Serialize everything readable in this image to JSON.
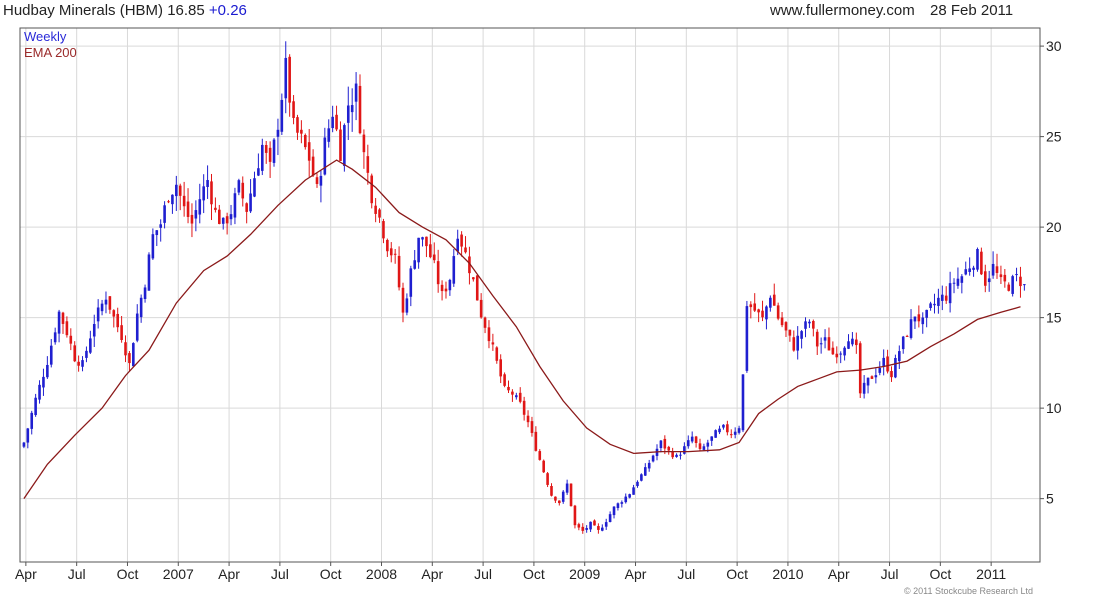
{
  "header": {
    "symbol_text": "Hudbay Minerals (HBM) 16.85",
    "change": "+0.26",
    "site": "www.fullermoney.com",
    "date": "28 Feb 2011"
  },
  "legend": {
    "weekly": "Weekly",
    "ema": "EMA 200"
  },
  "credit": "© 2011 Stockcube Research Ltd",
  "colors": {
    "up": "#1f1fd0",
    "down": "#e01616",
    "ema": "#8b1a1a",
    "grid": "#d9d9d9",
    "axis": "#555555"
  },
  "chart_data": {
    "type": "candlestick",
    "ylim": [
      1.5,
      31
    ],
    "yticks": [
      5,
      10,
      15,
      20,
      25,
      30
    ],
    "xlabels": [
      {
        "label": "Apr",
        "x": 0.5
      },
      {
        "label": "Jul",
        "x": 13.5
      },
      {
        "label": "Oct",
        "x": 26.5
      },
      {
        "label": "2007",
        "x": 39.5
      },
      {
        "label": "Apr",
        "x": 52.5
      },
      {
        "label": "Jul",
        "x": 65.5
      },
      {
        "label": "Oct",
        "x": 78.5
      },
      {
        "label": "2008",
        "x": 91.5
      },
      {
        "label": "Apr",
        "x": 104.5
      },
      {
        "label": "Jul",
        "x": 117.5
      },
      {
        "label": "Oct",
        "x": 130.5
      },
      {
        "label": "2009",
        "x": 143.5
      },
      {
        "label": "Apr",
        "x": 156.5
      },
      {
        "label": "Jul",
        "x": 169.5
      },
      {
        "label": "Oct",
        "x": 182.5
      },
      {
        "label": "2010",
        "x": 195.5
      },
      {
        "label": "Apr",
        "x": 208.5
      },
      {
        "label": "Jul",
        "x": 221.5
      },
      {
        "label": "Oct",
        "x": 234.5
      },
      {
        "label": "2011",
        "x": 247.5
      }
    ],
    "xrange": [
      -1,
      260
    ],
    "series": [
      {
        "name": "Weekly",
        "kind": "candles"
      },
      {
        "name": "EMA 200",
        "kind": "line"
      }
    ],
    "ema": [
      [
        0,
        5.0
      ],
      [
        6,
        6.9
      ],
      [
        13,
        8.5
      ],
      [
        20,
        10.0
      ],
      [
        26,
        11.8
      ],
      [
        32,
        13.2
      ],
      [
        39,
        15.8
      ],
      [
        46,
        17.6
      ],
      [
        52,
        18.4
      ],
      [
        58,
        19.6
      ],
      [
        65,
        21.2
      ],
      [
        72,
        22.6
      ],
      [
        80,
        23.7
      ],
      [
        84,
        23.2
      ],
      [
        90,
        22.2
      ],
      [
        96,
        20.8
      ],
      [
        102,
        20.0
      ],
      [
        108,
        19.3
      ],
      [
        114,
        18.0
      ],
      [
        120,
        16.2
      ],
      [
        126,
        14.5
      ],
      [
        132,
        12.3
      ],
      [
        138,
        10.4
      ],
      [
        144,
        8.9
      ],
      [
        150,
        8.0
      ],
      [
        156,
        7.5
      ],
      [
        163,
        7.6
      ],
      [
        170,
        7.6
      ],
      [
        178,
        7.7
      ],
      [
        183,
        8.1
      ],
      [
        188,
        9.7
      ],
      [
        193,
        10.5
      ],
      [
        198,
        11.2
      ],
      [
        203,
        11.6
      ],
      [
        208,
        12.0
      ],
      [
        214,
        12.1
      ],
      [
        220,
        12.3
      ],
      [
        226,
        12.6
      ],
      [
        232,
        13.4
      ],
      [
        238,
        14.1
      ],
      [
        244,
        14.9
      ],
      [
        250,
        15.3
      ],
      [
        255,
        15.6
      ]
    ],
    "anchors": [
      [
        0,
        8.1
      ],
      [
        3,
        10.5
      ],
      [
        6,
        12.6
      ],
      [
        9,
        15.3
      ],
      [
        11,
        14.2
      ],
      [
        13,
        12.8
      ],
      [
        15,
        12.4
      ],
      [
        18,
        14.8
      ],
      [
        21,
        16.2
      ],
      [
        23,
        15.0
      ],
      [
        25,
        14.0
      ],
      [
        27,
        12.4
      ],
      [
        29,
        15.2
      ],
      [
        31,
        17.0
      ],
      [
        33,
        19.5
      ],
      [
        35,
        20.2
      ],
      [
        37,
        21.8
      ],
      [
        39,
        22.4
      ],
      [
        41,
        21.0
      ],
      [
        43,
        20.2
      ],
      [
        45,
        21.6
      ],
      [
        47,
        22.6
      ],
      [
        49,
        20.8
      ],
      [
        51,
        20.1
      ],
      [
        53,
        20.9
      ],
      [
        55,
        22.2
      ],
      [
        57,
        21.0
      ],
      [
        59,
        22.8
      ],
      [
        61,
        24.5
      ],
      [
        63,
        23.2
      ],
      [
        65,
        25.8
      ],
      [
        67,
        28.8
      ],
      [
        69,
        25.5
      ],
      [
        71,
        24.8
      ],
      [
        73,
        23.8
      ],
      [
        75,
        22.0
      ],
      [
        77,
        24.6
      ],
      [
        79,
        26.4
      ],
      [
        81,
        24.2
      ],
      [
        83,
        26.8
      ],
      [
        85,
        27.5
      ],
      [
        87,
        24.0
      ],
      [
        89,
        21.8
      ],
      [
        91,
        20.5
      ],
      [
        93,
        19.0
      ],
      [
        95,
        18.2
      ],
      [
        97,
        15.2
      ],
      [
        99,
        17.5
      ],
      [
        101,
        19.5
      ],
      [
        103,
        19.0
      ],
      [
        105,
        17.8
      ],
      [
        107,
        16.2
      ],
      [
        109,
        17.2
      ],
      [
        111,
        19.8
      ],
      [
        113,
        18.5
      ],
      [
        115,
        17.0
      ],
      [
        117,
        15.2
      ],
      [
        119,
        14.0
      ],
      [
        121,
        12.5
      ],
      [
        123,
        11.0
      ],
      [
        125,
        10.8
      ],
      [
        127,
        10.2
      ],
      [
        129,
        9.2
      ],
      [
        131,
        7.8
      ],
      [
        133,
        6.5
      ],
      [
        135,
        5.2
      ],
      [
        137,
        4.8
      ],
      [
        139,
        5.8
      ],
      [
        141,
        3.5
      ],
      [
        143,
        3.2
      ],
      [
        145,
        3.6
      ],
      [
        147,
        3.2
      ],
      [
        149,
        3.8
      ],
      [
        151,
        4.5
      ],
      [
        153,
        4.9
      ],
      [
        155,
        5.3
      ],
      [
        157,
        6.0
      ],
      [
        159,
        6.6
      ],
      [
        161,
        7.4
      ],
      [
        163,
        8.1
      ],
      [
        165,
        7.6
      ],
      [
        167,
        7.3
      ],
      [
        169,
        7.8
      ],
      [
        171,
        8.4
      ],
      [
        173,
        7.6
      ],
      [
        175,
        8.1
      ],
      [
        177,
        8.6
      ],
      [
        179,
        8.9
      ],
      [
        181,
        8.6
      ],
      [
        183,
        9.0
      ],
      [
        184,
        11.8
      ],
      [
        185,
        15.8
      ],
      [
        187,
        15.4
      ],
      [
        189,
        14.9
      ],
      [
        191,
        16.3
      ],
      [
        193,
        15.0
      ],
      [
        195,
        14.2
      ],
      [
        197,
        13.4
      ],
      [
        199,
        14.3
      ],
      [
        201,
        14.8
      ],
      [
        203,
        13.5
      ],
      [
        205,
        13.7
      ],
      [
        207,
        13.0
      ],
      [
        209,
        13.2
      ],
      [
        211,
        14.0
      ],
      [
        213,
        13.2
      ],
      [
        214,
        10.8
      ],
      [
        216,
        11.5
      ],
      [
        218,
        12.0
      ],
      [
        220,
        12.6
      ],
      [
        222,
        11.9
      ],
      [
        224,
        13.2
      ],
      [
        226,
        14.2
      ],
      [
        228,
        15.2
      ],
      [
        230,
        14.7
      ],
      [
        232,
        15.5
      ],
      [
        234,
        16.0
      ],
      [
        236,
        16.2
      ],
      [
        238,
        17.0
      ],
      [
        240,
        17.3
      ],
      [
        242,
        17.9
      ],
      [
        244,
        18.4
      ],
      [
        246,
        17.0
      ],
      [
        248,
        17.8
      ],
      [
        250,
        16.9
      ],
      [
        252,
        16.8
      ],
      [
        254,
        17.2
      ],
      [
        256,
        16.85
      ]
    ]
  }
}
